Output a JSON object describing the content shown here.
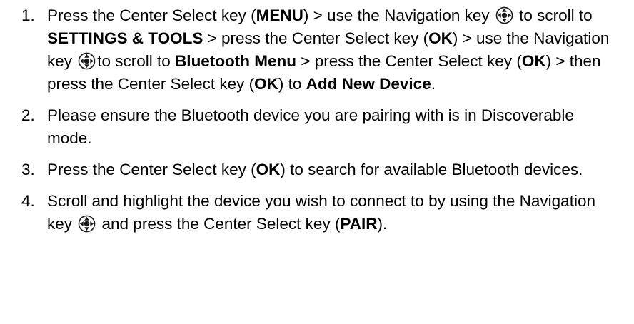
{
  "steps": [
    {
      "number": "1.",
      "parts": [
        {
          "t": "text",
          "v": "Press the Center Select key ("
        },
        {
          "t": "bold",
          "v": "MENU"
        },
        {
          "t": "text",
          "v": ") > use the Navigation key "
        },
        {
          "t": "icon",
          "v": "navigation-key-icon"
        },
        {
          "t": "text",
          "v": " to scroll to "
        },
        {
          "t": "bold",
          "v": "SETTINGS & TOOLS"
        },
        {
          "t": "text",
          "v": " > press the Center Select key ("
        },
        {
          "t": "bold",
          "v": "OK"
        },
        {
          "t": "text",
          "v": ") > use the Navigation key "
        },
        {
          "t": "icon",
          "v": "navigation-key-icon"
        },
        {
          "t": "text",
          "v": "to scroll to "
        },
        {
          "t": "bold",
          "v": "Bluetooth Menu"
        },
        {
          "t": "text",
          "v": " > press the Center Select key ("
        },
        {
          "t": "bold",
          "v": "OK"
        },
        {
          "t": "text",
          "v": ") > then press the Center Select key ("
        },
        {
          "t": "bold",
          "v": "OK"
        },
        {
          "t": "text",
          "v": ") to "
        },
        {
          "t": "bold",
          "v": "Add New Device"
        },
        {
          "t": "text",
          "v": "."
        }
      ]
    },
    {
      "number": "2.",
      "parts": [
        {
          "t": "text",
          "v": "Please ensure the Bluetooth device you are pairing with is in Discoverable mode."
        }
      ]
    },
    {
      "number": "3.",
      "parts": [
        {
          "t": "text",
          "v": "Press the Center Select key ("
        },
        {
          "t": "bold",
          "v": "OK"
        },
        {
          "t": "text",
          "v": ") to search for available Bluetooth devices."
        }
      ]
    },
    {
      "number": "4.",
      "parts": [
        {
          "t": "text",
          "v": "Scroll and highlight the device you wish to connect to by using the Navigation key "
        },
        {
          "t": "icon",
          "v": "navigation-key-icon"
        },
        {
          "t": "text",
          "v": " and press the Center Select key ("
        },
        {
          "t": "bold",
          "v": "PAIR"
        },
        {
          "t": "text",
          "v": ")."
        }
      ]
    }
  ]
}
